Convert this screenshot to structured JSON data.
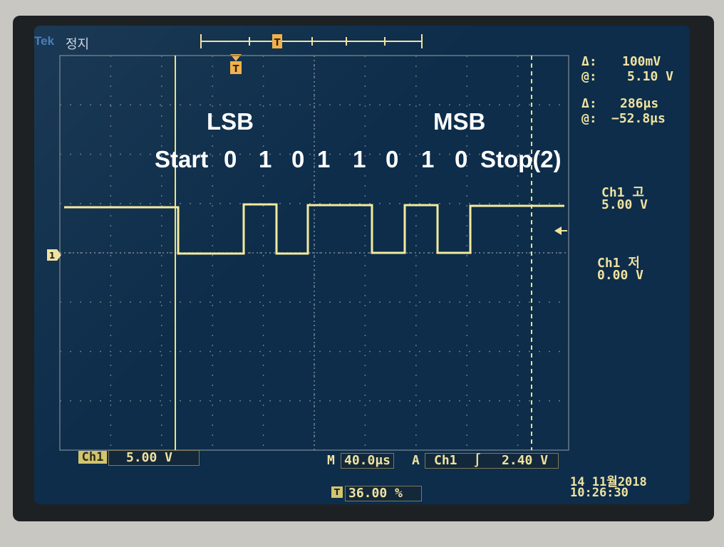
{
  "header": {
    "brand": "Tek",
    "run_state": "정지"
  },
  "cursor_readout": {
    "voltage_delta_label": "Δ:",
    "voltage_delta": "100mV",
    "voltage_at_label": "@:",
    "voltage_at": "5.10 V",
    "time_delta_label": "Δ:",
    "time_delta": "286μs",
    "time_at_label": "@:",
    "time_at": "−52.8μs"
  },
  "channel_levels": {
    "ch1_high_label": "Ch1 고",
    "ch1_high_value": "5.00 V",
    "ch1_low_label": "Ch1 저",
    "ch1_low_value": "0.00 V"
  },
  "annotations": {
    "lsb": "LSB",
    "msb": "MSB",
    "bits_start": "Start",
    "bits": [
      "0",
      "1",
      "0",
      "1",
      "1",
      "0",
      "1",
      "0"
    ],
    "bits_stop": "Stop(2)"
  },
  "status_bar": {
    "channel_badge": "Ch1",
    "channel_scale": "5.00 V",
    "timebase_prefix": "M",
    "timebase": "40.0μs",
    "trigger_prefix": "A",
    "trigger_source": "Ch1",
    "trigger_slope_glyph": "∫",
    "trigger_level": "2.40 V",
    "trigger_position_icon": "T",
    "trigger_position": "36.00 %",
    "date": "14 11월2018",
    "time": "10:26:30"
  },
  "ground_marker": "1",
  "trigger_top_marker": "T",
  "colors": {
    "trace": "#f5ea9c",
    "grid": "#6b7a86",
    "screen_bg": "#0d2d4a",
    "label": "#f0e2a0"
  }
}
